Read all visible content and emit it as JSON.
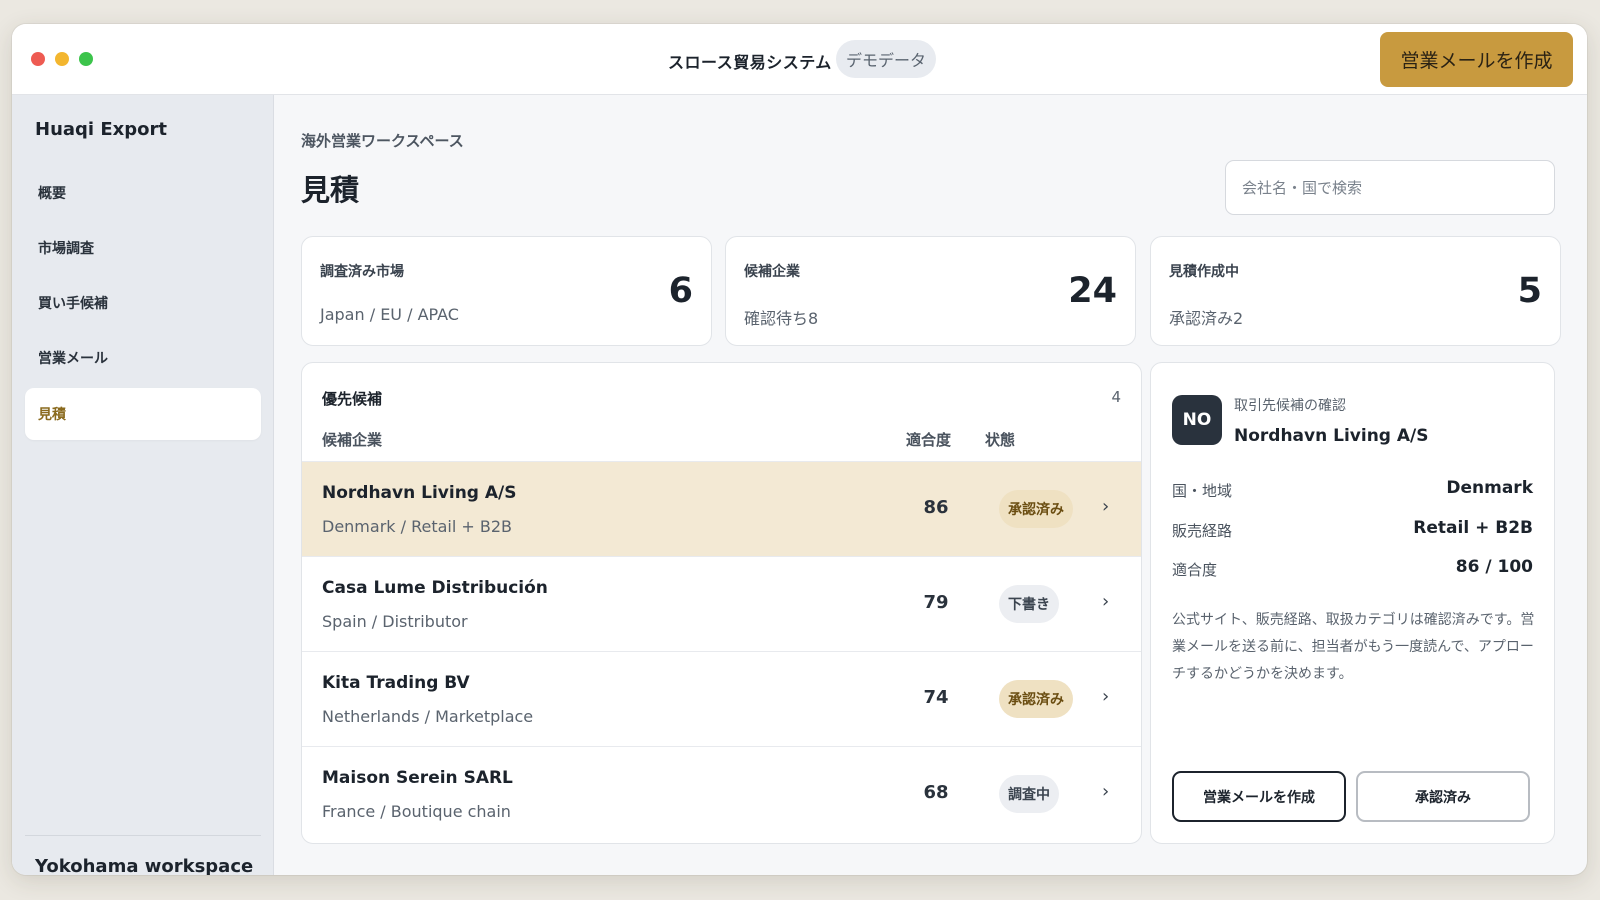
{
  "window": {
    "app_title": "スロース貿易システム",
    "demo_badge": "デモデータ",
    "compose_button": "営業メールを作成"
  },
  "sidebar": {
    "brand": "Huaqi Export",
    "items": [
      {
        "label": "概要",
        "active": false
      },
      {
        "label": "市場調査",
        "active": false
      },
      {
        "label": "買い手候補",
        "active": false
      },
      {
        "label": "営業メール",
        "active": false
      },
      {
        "label": "見積",
        "active": true
      }
    ],
    "workspace": "Yokohama workspace"
  },
  "header": {
    "eyebrow": "海外営業ワークスペース",
    "title": "見積",
    "search_placeholder": "会社名・国で検索"
  },
  "stats": [
    {
      "label": "調査済み市場",
      "sub": "Japan / EU / APAC",
      "value": "6"
    },
    {
      "label": "候補企業",
      "sub": "確認待ち8",
      "value": "24"
    },
    {
      "label": "見積作成中",
      "sub": "承認済み2",
      "value": "5"
    }
  ],
  "candidates": {
    "title": "優先候補",
    "count": "4",
    "columns": {
      "company": "候補企業",
      "score": "適合度",
      "status": "状態"
    },
    "rows": [
      {
        "name": "Nordhavn Living A/S",
        "sub": "Denmark / Retail + B2B",
        "score": "86",
        "status": "承認済み",
        "status_kind": "approved",
        "selected": true
      },
      {
        "name": "Casa Lume Distribución",
        "sub": "Spain / Distributor",
        "score": "79",
        "status": "下書き",
        "status_kind": "draft",
        "selected": false
      },
      {
        "name": "Kita Trading BV",
        "sub": "Netherlands / Marketplace",
        "score": "74",
        "status": "承認済み",
        "status_kind": "approved",
        "selected": false
      },
      {
        "name": "Maison Serein SARL",
        "sub": "France / Boutique chain",
        "score": "68",
        "status": "調査中",
        "status_kind": "review",
        "selected": false
      }
    ]
  },
  "detail": {
    "avatar": "NO",
    "eyebrow": "取引先候補の確認",
    "name": "Nordhavn Living A/S",
    "fields": [
      {
        "label": "国・地域",
        "value": "Denmark"
      },
      {
        "label": "販売経路",
        "value": "Retail + B2B"
      },
      {
        "label": "適合度",
        "value": "86 / 100"
      }
    ],
    "note": "公式サイト、販売経路、取扱カテゴリは確認済みです。営業メールを送る前に、担当者がもう一度読んで、アプローチするかどうかを決めます。",
    "primary_button": "営業メールを作成",
    "secondary_button": "承認済み"
  },
  "colors": {
    "accent": "#c89a3f",
    "selected_row": "#f3e9d4",
    "approved_badge": "#efe1c2",
    "avatar_bg": "#29323d"
  }
}
